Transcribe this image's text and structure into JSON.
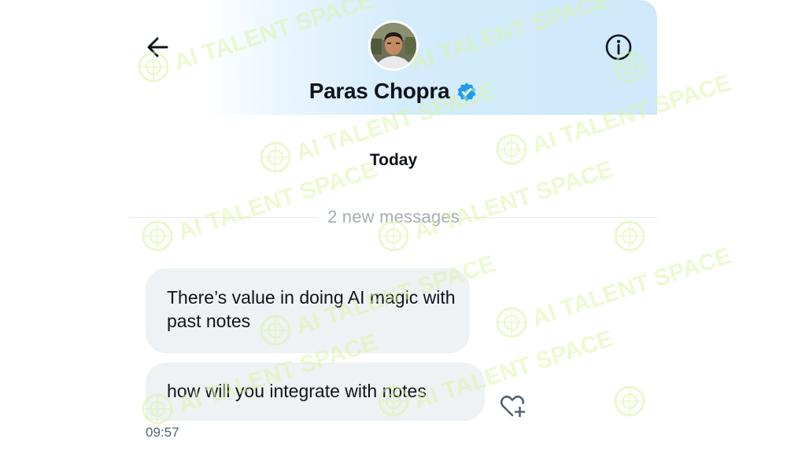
{
  "contact": {
    "name": "Paras Chopra",
    "verified": true
  },
  "icons": {
    "back": "arrow-left-icon",
    "info": "info-circle-icon",
    "verified": "verified-badge-icon",
    "react": "heart-plus-icon"
  },
  "conversation": {
    "day_label": "Today",
    "new_messages_label": "2 new messages",
    "messages": [
      {
        "text": "There’s value in doing AI magic with past notes"
      },
      {
        "text": "how will you integrate with notes"
      }
    ],
    "last_timestamp": "09:57"
  },
  "watermark": {
    "text": "AI TALENT SPACE"
  },
  "colors": {
    "header_gradient": "#cfe9fb",
    "bubble": "#eff2f4",
    "verified": "#1d9bf0",
    "watermark": "#d8f5a2"
  }
}
